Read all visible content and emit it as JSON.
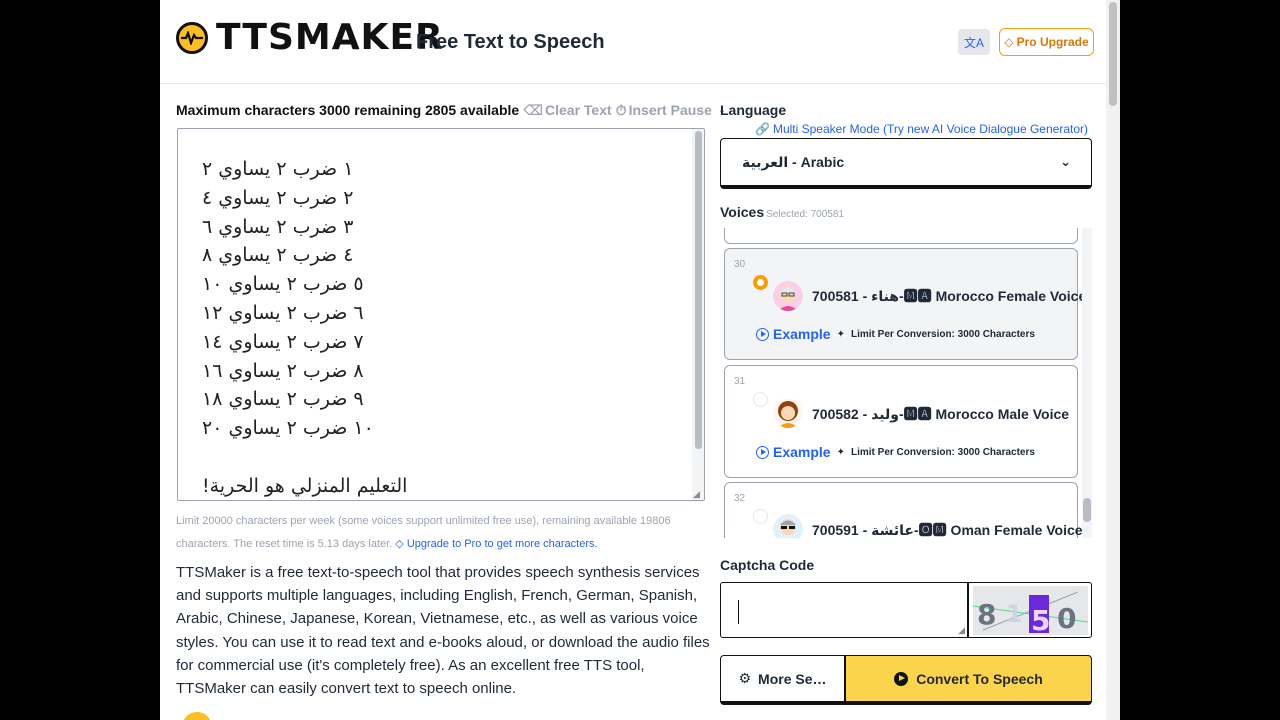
{
  "header": {
    "brand": "TTSMAKER",
    "tagline": "Free Text to Speech",
    "pro_label": "Pro Upgrade",
    "translate_icon": "translate-icon"
  },
  "editor": {
    "max_chars_text": "Maximum characters 3000 remaining 2805 available",
    "clear_text": "Clear Text",
    "insert_pause": "Insert Pause",
    "lines": [
      "١ ضرب ٢ يساوي ٢",
      "٢ ضرب ٢ يساوي ٤",
      "٣ ضرب ٢ يساوي ٦",
      "٤ ضرب ٢ يساوي ٨",
      "٥ ضرب ٢ يساوي ١٠",
      "٦ ضرب ٢ يساوي ١٢",
      "٧ ضرب ٢ يساوي ١٤",
      "٨ ضرب ٢ يساوي ١٦",
      "٩ ضرب ٢ يساوي ١٨",
      "١٠ ضرب ٢ يساوي ٢٠"
    ],
    "last_line": "التعليم المنزلي هو الحرية!"
  },
  "limit_note": {
    "text": "Limit 20000 characters per week (some voices support unlimited free use), remaining available 19806 characters. The reset time is 5.13 days later.",
    "upgrade_link": "Upgrade to Pro to get more characters."
  },
  "description": "TTSMaker is a free text-to-speech tool that provides speech synthesis services and supports multiple languages, including English, French, German, Spanish, Arabic, Chinese, Japanese, Korean, Vietnamese, etc., as well as various voice styles. You can use it to read text and e-books aloud, or download the audio files for commercial use (it's completely free). As an excellent free TTS tool, TTSMaker can easily convert text to speech online.",
  "language": {
    "label": "Language",
    "multi_speaker_link": "Multi Speaker Mode (Try new AI Voice Dialogue Generator)",
    "selected": "العربية - Arabic"
  },
  "voices": {
    "label": "Voices",
    "selected_text": "Selected: 700581",
    "items": [
      {
        "num": "30",
        "name": "700581 - هناء-🅼🅰 Morocco Female Voice",
        "example": "Example",
        "limit": "Limit Per Conversion: 3000 Characters",
        "selected": true
      },
      {
        "num": "31",
        "name": "700582 - وليد-🅼🅰 Morocco Male Voice",
        "example": "Example",
        "limit": "Limit Per Conversion: 3000 Characters",
        "selected": false
      },
      {
        "num": "32",
        "name": "700591 - عائشة-🅾🅼 Oman Female Voice",
        "example": "",
        "limit": "",
        "selected": false
      }
    ]
  },
  "captcha": {
    "label": "Captcha Code",
    "value": "",
    "image_text": "8150"
  },
  "actions": {
    "more_settings": "More Se…",
    "convert": "Convert To Speech"
  }
}
